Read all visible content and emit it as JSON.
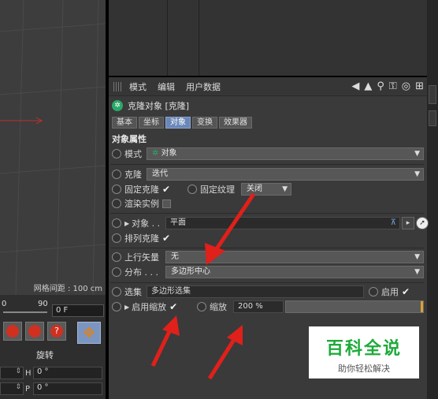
{
  "viewport": {
    "grid_spacing": "网格间距 : 100 cm"
  },
  "timeline": {
    "tick_0": "0",
    "tick_90": "90",
    "frame": "0 F"
  },
  "tools": {
    "icons": [
      "transform-icon",
      "rotate-icon",
      "help-icon"
    ],
    "move_icon": "move-icon"
  },
  "coords": {
    "section": "旋转",
    "rows": [
      {
        "label": "H",
        "value": "0 °"
      },
      {
        "label": "P",
        "value": "0 °"
      }
    ]
  },
  "attr": {
    "menu": [
      "模式",
      "编辑",
      "用户数据"
    ],
    "object_title": "克隆对象 [克隆]",
    "tabs": [
      "基本",
      "坐标",
      "对象",
      "变换",
      "效果器"
    ],
    "active_tab": "对象",
    "section_title": "对象属性",
    "mode_label": "模式",
    "mode_value": "对象",
    "clone_label": "克隆",
    "clone_value": "迭代",
    "fixed_clone_label": "固定克隆",
    "fixed_texture_label": "固定纹理",
    "fixed_texture_value": "关闭",
    "render_instance_label": "渲染实例",
    "object_label": "对象 . .",
    "object_value": "平面",
    "arrange_clone_label": "排列克隆",
    "up_vector_label": "上行矢量",
    "up_vector_value": "无",
    "distribution_label": "分布 . . .",
    "distribution_value": "多边形中心",
    "selection_label": "选集",
    "selection_value": "多边形选集",
    "enable_label": "启用",
    "enable_scale_label": "启用缩放",
    "scale_label": "缩放",
    "scale_value": "200 %"
  },
  "watermark": {
    "title": "百科全说",
    "subtitle": "助你轻松解决"
  },
  "colors": {
    "accent_tab": "#6b87b8",
    "arrow_red": "#e0201a",
    "watermark_green": "#1eaa3a"
  }
}
